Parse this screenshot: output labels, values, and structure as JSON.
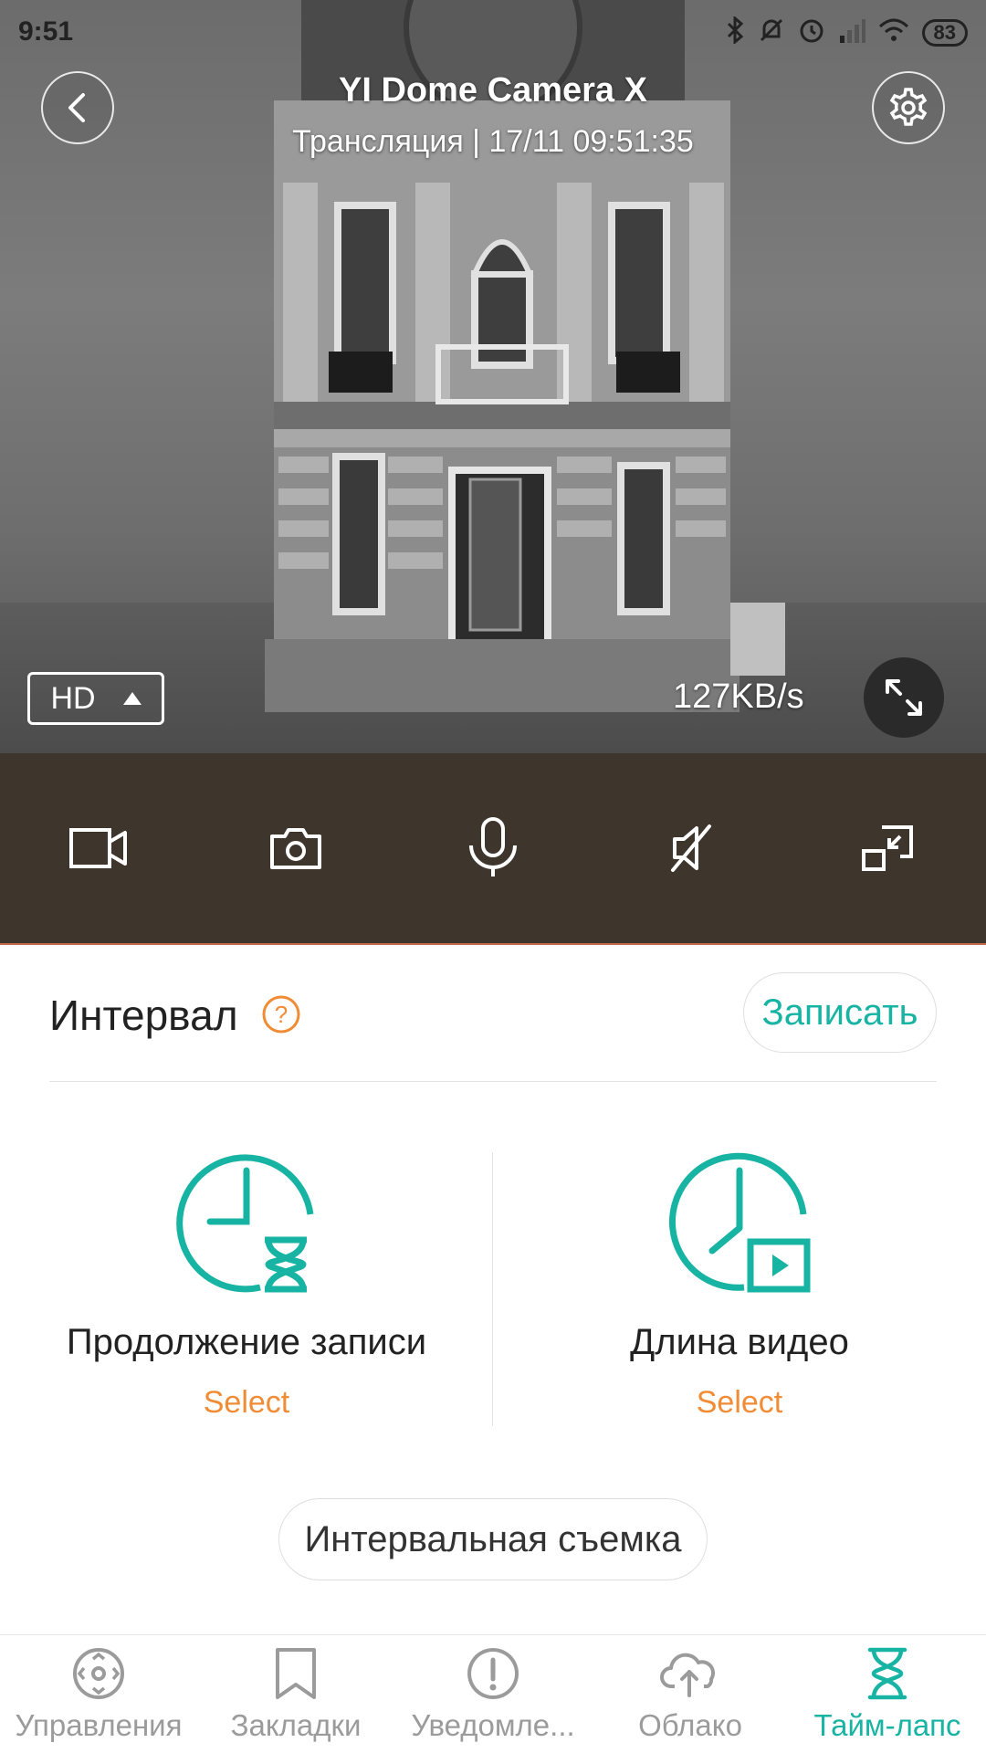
{
  "status_bar": {
    "time": "9:51",
    "battery": "83"
  },
  "camera": {
    "title": "YI Dome Camera X",
    "subtitle": "Трансляция | 17/11 09:51:35",
    "quality": "HD",
    "bitrate": "127KB/s"
  },
  "controls": {
    "icons": [
      "video-record-icon",
      "camera-icon",
      "microphone-icon",
      "speaker-mute-icon",
      "picture-in-picture-icon"
    ]
  },
  "timelapse": {
    "title": "Интервал",
    "record_label": "Записать",
    "options": [
      {
        "label": "Продолжение записи",
        "value": "Select"
      },
      {
        "label": "Длина видео",
        "value": "Select"
      }
    ],
    "action_label": "Интервальная съемка"
  },
  "nav": {
    "items": [
      {
        "label": "Управления",
        "icon": "control-icon"
      },
      {
        "label": "Закладки",
        "icon": "bookmark-icon"
      },
      {
        "label": "Уведомле...",
        "icon": "alert-icon"
      },
      {
        "label": "Облако",
        "icon": "cloud-icon"
      },
      {
        "label": "Тайм-лапс",
        "icon": "hourglass-icon",
        "active": true
      }
    ]
  },
  "colors": {
    "accent": "#17b3a3",
    "highlight": "#f08c35",
    "controls_bg": "#3e352c"
  }
}
